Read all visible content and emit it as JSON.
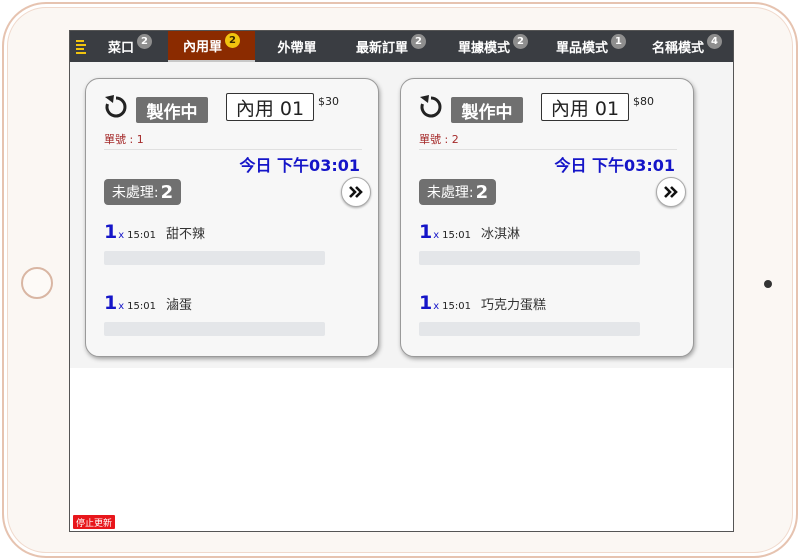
{
  "tabs": [
    {
      "label": "菜口",
      "badge": "2",
      "active": false
    },
    {
      "label": "內用單",
      "badge": "2",
      "active": true
    },
    {
      "label": "外帶單",
      "badge": "",
      "active": false
    },
    {
      "label": "最新訂單",
      "badge": "2",
      "active": false
    },
    {
      "label": "單據模式",
      "badge": "2",
      "active": false
    },
    {
      "label": "單品模式",
      "badge": "1",
      "active": false
    },
    {
      "label": "名稱模式",
      "badge": "4",
      "active": false
    }
  ],
  "orders": [
    {
      "status": "製作中",
      "table": "內用 01",
      "price": "$30",
      "order_number": "單號 : 1",
      "time": "今日 下午03:01",
      "pending_label": "未處理:",
      "pending_count": "2",
      "items": [
        {
          "qty": "1",
          "x": "x",
          "time": "15:01",
          "name": "甜不辣"
        },
        {
          "qty": "1",
          "x": "x",
          "time": "15:01",
          "name": "滷蛋"
        }
      ]
    },
    {
      "status": "製作中",
      "table": "內用 01",
      "price": "$80",
      "order_number": "單號 : 2",
      "time": "今日 下午03:01",
      "pending_label": "未處理:",
      "pending_count": "2",
      "items": [
        {
          "qty": "1",
          "x": "x",
          "time": "15:01",
          "name": "冰淇淋"
        },
        {
          "qty": "1",
          "x": "x",
          "time": "15:01",
          "name": "巧克力蛋糕"
        }
      ]
    }
  ],
  "footer": {
    "stop_update_label": "停止更新"
  },
  "icons": {
    "menu": "menu-icon",
    "refresh": "refresh-icon",
    "forward": "double-chevron-right-icon"
  },
  "colors": {
    "tabbar": "#3a3d42",
    "active_tab": "#8b2b00",
    "accent_badge": "#f1c40f",
    "time_blue": "#1515c8",
    "stop_red": "#e8161b"
  }
}
